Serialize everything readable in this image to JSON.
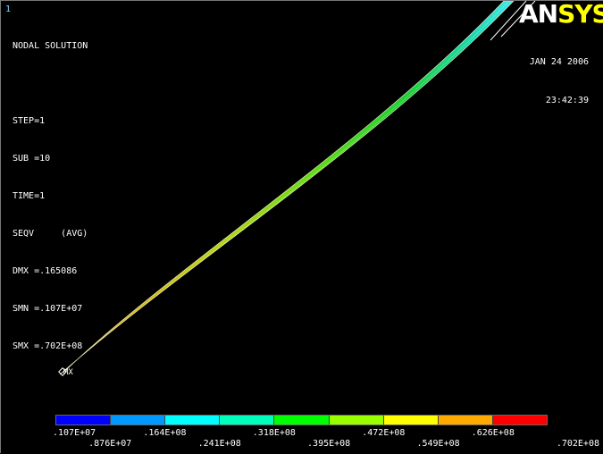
{
  "window": {
    "number": "1"
  },
  "brand": {
    "part1": "AN",
    "part2": "SYS"
  },
  "info": {
    "title": "NODAL SOLUTION",
    "step": "STEP=1",
    "sub": "SUB =10",
    "time": "TIME=1",
    "quantity": "SEQV     (AVG)",
    "dmx": "DMX =.165086",
    "smn": "SMN =.107E+07",
    "smx": "SMX =.702E+08"
  },
  "datetime": {
    "date": "JAN 24 2006",
    "time": "23:42:39"
  },
  "model": {
    "max_marker_label": "MX"
  },
  "legend": {
    "colors": [
      "#0000ff",
      "#0099ff",
      "#00ffff",
      "#00ffbb",
      "#00ff00",
      "#99ff00",
      "#ffff00",
      "#ffaa00",
      "#ff0000"
    ],
    "labels": [
      ".107E+07",
      ".876E+07",
      ".164E+08",
      ".241E+08",
      ".318E+08",
      ".395E+08",
      ".472E+08",
      ".549E+08",
      ".626E+08",
      ".702E+08"
    ]
  }
}
